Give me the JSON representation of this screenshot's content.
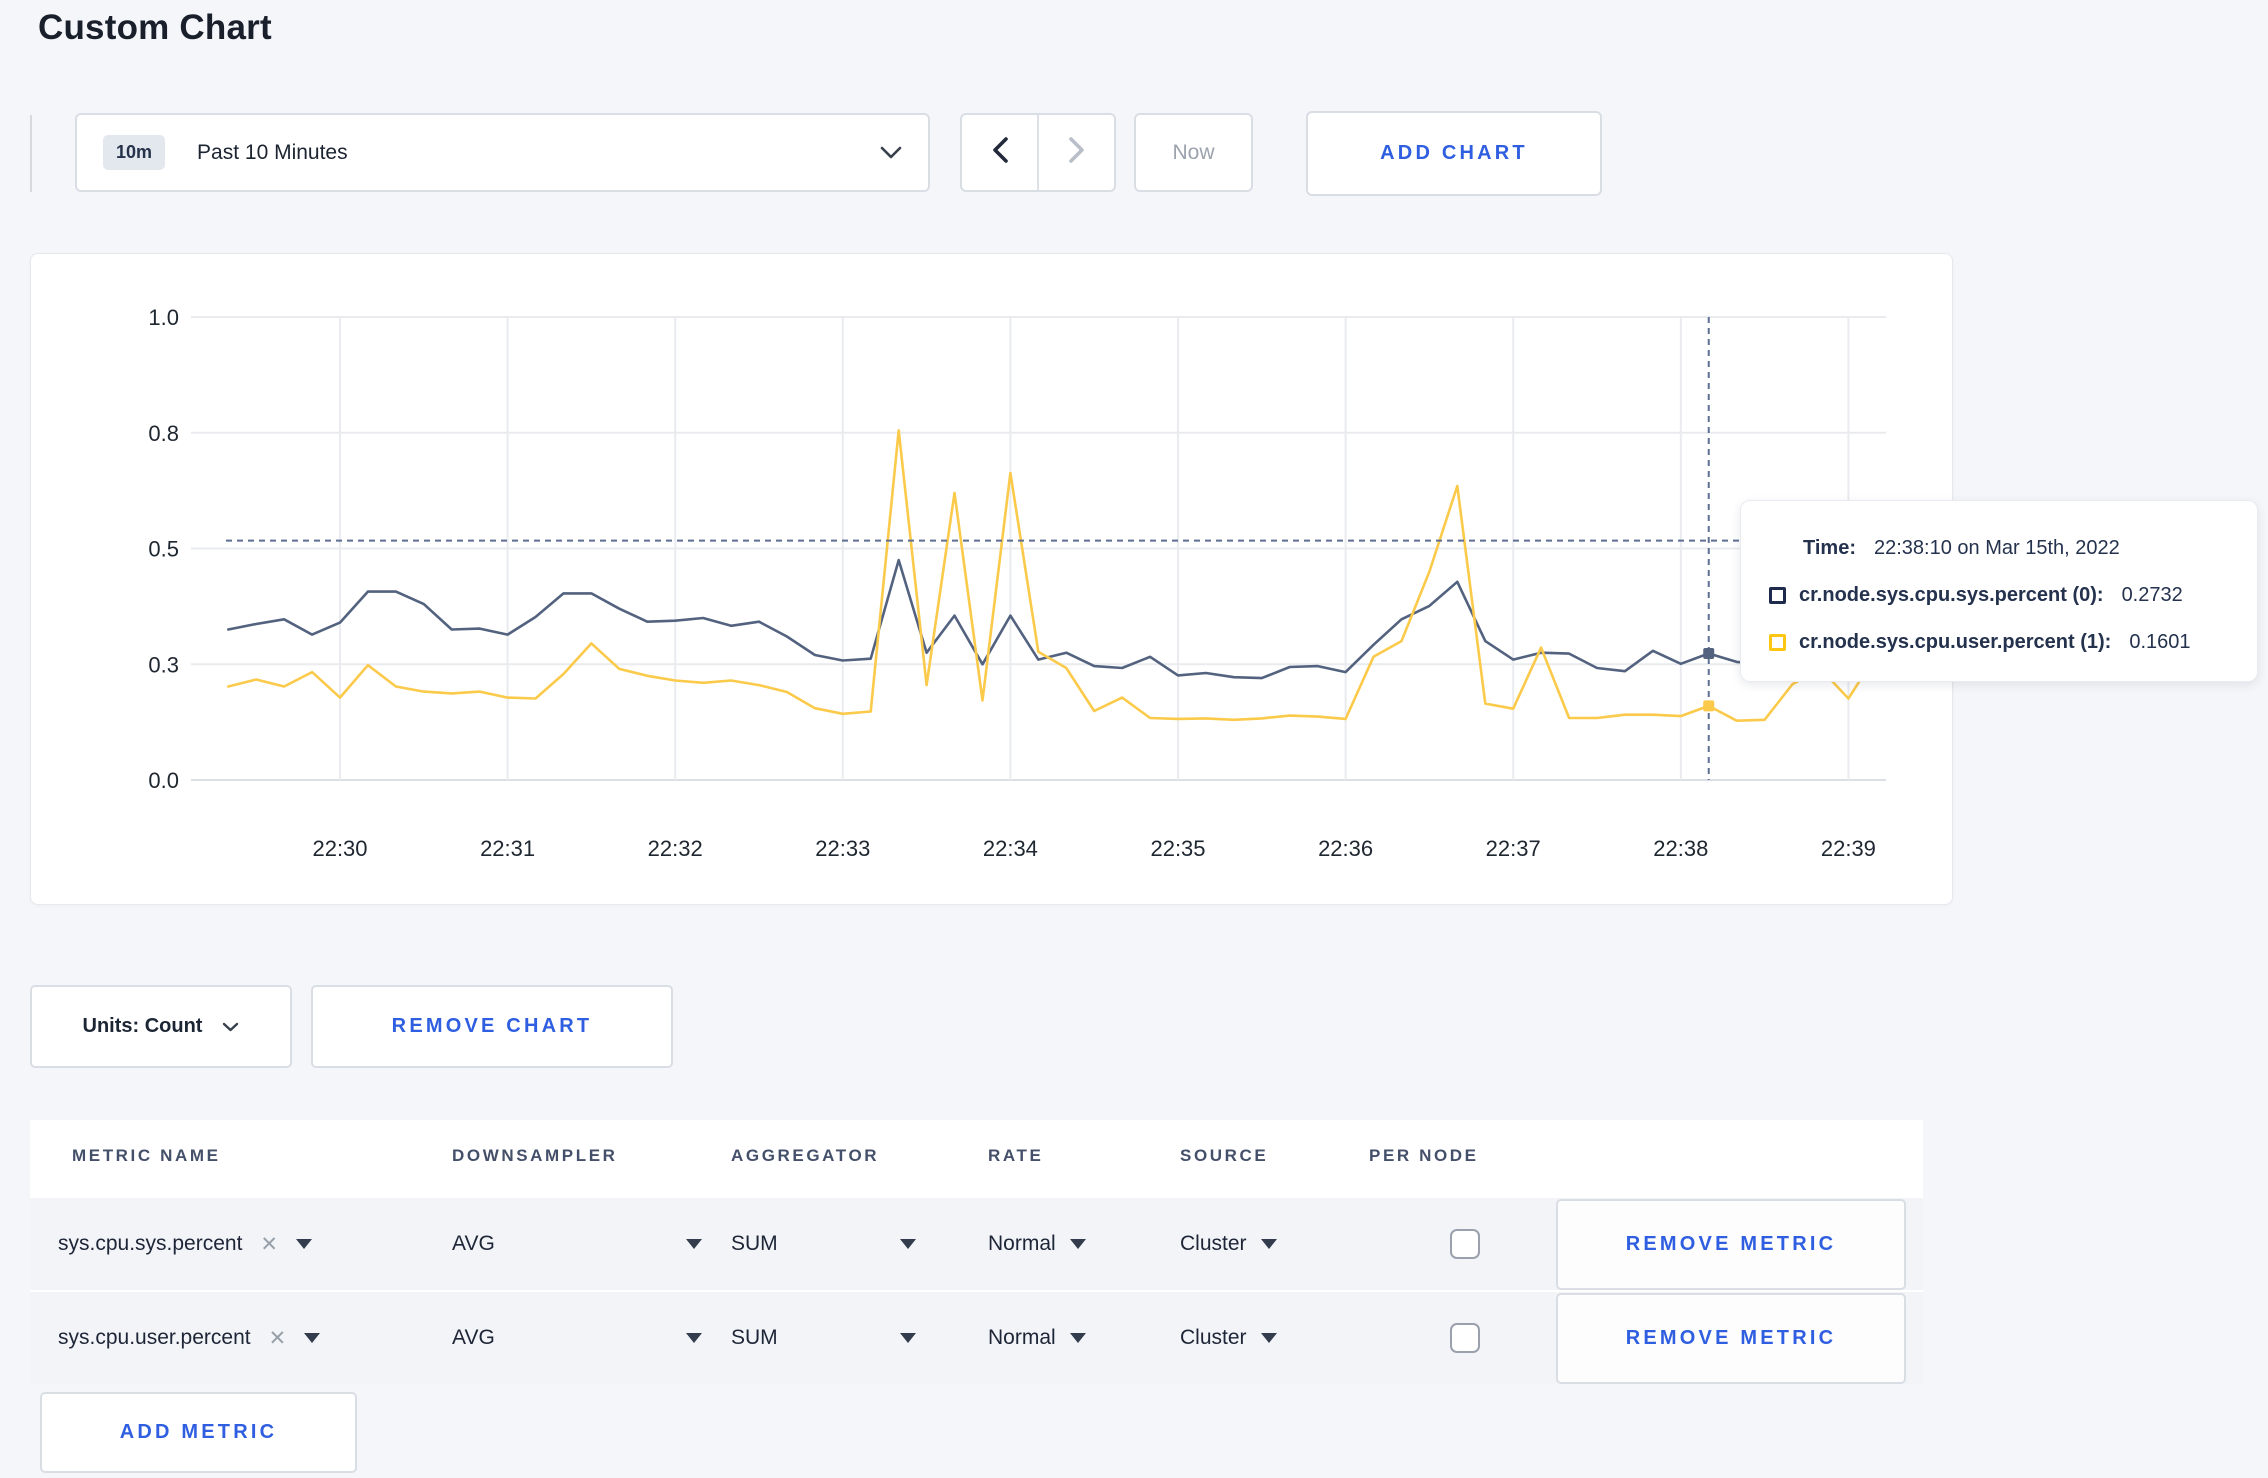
{
  "page": {
    "title": "Custom Chart"
  },
  "toolbar": {
    "time_badge": "10m",
    "time_label": "Past 10 Minutes",
    "now_label": "Now",
    "add_chart_label": "ADD CHART"
  },
  "chart_controls": {
    "units_label": "Units: Count",
    "remove_chart_label": "REMOVE CHART",
    "add_metric_label": "ADD METRIC"
  },
  "tooltip": {
    "time_label": "Time:",
    "time_value": "22:38:10 on Mar 15th, 2022",
    "series": [
      {
        "label": "cr.node.sys.cpu.sys.percent (0):",
        "value": "0.2732",
        "color": "#1f2b4d"
      },
      {
        "label": "cr.node.sys.cpu.user.percent (1):",
        "value": "0.1601",
        "color": "#fcc713"
      }
    ]
  },
  "chart_data": {
    "type": "line",
    "title": "",
    "xlabel": "",
    "ylabel": "",
    "grid": true,
    "legend_position": "tooltip",
    "x_axis": {
      "start_time": "22:29:20",
      "interval_seconds": 10,
      "tick_labels": [
        "22:30",
        "22:31",
        "22:32",
        "22:33",
        "22:34",
        "22:35",
        "22:36",
        "22:37",
        "22:38",
        "22:39"
      ]
    },
    "y_axis": {
      "range": [
        0,
        1
      ],
      "tick_values": [
        0,
        0.25,
        0.5,
        0.75,
        1.0
      ],
      "tick_labels": [
        "0.0",
        "0.3",
        "0.5",
        "0.8",
        "1.0"
      ]
    },
    "series": [
      {
        "name": "cr.node.sys.cpu.sys.percent (0)",
        "color": "#53627f",
        "values": [
          0.325,
          0.337,
          0.347,
          0.314,
          0.34,
          0.407,
          0.407,
          0.38,
          0.325,
          0.327,
          0.314,
          0.352,
          0.403,
          0.403,
          0.37,
          0.342,
          0.344,
          0.35,
          0.333,
          0.342,
          0.31,
          0.27,
          0.258,
          0.262,
          0.475,
          0.275,
          0.355,
          0.25,
          0.355,
          0.26,
          0.275,
          0.246,
          0.242,
          0.266,
          0.226,
          0.231,
          0.222,
          0.22,
          0.244,
          0.246,
          0.233,
          0.292,
          0.347,
          0.376,
          0.428,
          0.3,
          0.26,
          0.275,
          0.273,
          0.242,
          0.235,
          0.279,
          0.251,
          0.2732,
          0.255,
          0.25,
          0.262,
          0.27,
          0.305,
          0.298
        ]
      },
      {
        "name": "cr.node.sys.cpu.user.percent (1)",
        "color": "#fbca4a",
        "values": [
          0.202,
          0.217,
          0.202,
          0.233,
          0.178,
          0.248,
          0.202,
          0.191,
          0.187,
          0.191,
          0.178,
          0.176,
          0.229,
          0.295,
          0.24,
          0.225,
          0.215,
          0.21,
          0.215,
          0.205,
          0.19,
          0.155,
          0.143,
          0.148,
          0.755,
          0.205,
          0.62,
          0.172,
          0.663,
          0.277,
          0.242,
          0.149,
          0.178,
          0.134,
          0.132,
          0.133,
          0.13,
          0.133,
          0.139,
          0.137,
          0.132,
          0.266,
          0.3,
          0.45,
          0.635,
          0.165,
          0.154,
          0.286,
          0.134,
          0.134,
          0.141,
          0.141,
          0.138,
          0.1601,
          0.128,
          0.13,
          0.207,
          0.24,
          0.176,
          0.27
        ]
      }
    ],
    "crosshair": {
      "time": "22:38:10",
      "index": 53,
      "hline_value": 0.517,
      "color": "#5d6f94",
      "sys_value": 0.2732,
      "user_value": 0.1601
    }
  },
  "metrics_table": {
    "headers": [
      "METRIC NAME",
      "DOWNSAMPLER",
      "AGGREGATOR",
      "RATE",
      "SOURCE",
      "PER NODE"
    ],
    "remove_metric_label": "REMOVE METRIC",
    "rows": [
      {
        "metric": "sys.cpu.sys.percent",
        "downsampler": "AVG",
        "aggregator": "SUM",
        "rate": "Normal",
        "source": "Cluster",
        "per_node_checked": false
      },
      {
        "metric": "sys.cpu.user.percent",
        "downsampler": "AVG",
        "aggregator": "SUM",
        "rate": "Normal",
        "source": "Cluster",
        "per_node_checked": false
      }
    ]
  }
}
